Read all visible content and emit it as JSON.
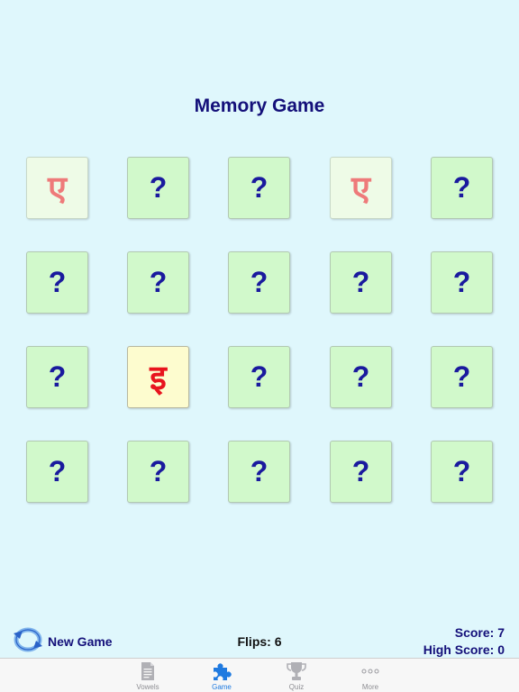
{
  "title": "Memory Game",
  "cards": [
    {
      "state": "matched",
      "text": "ए"
    },
    {
      "state": "hidden",
      "text": "?"
    },
    {
      "state": "hidden",
      "text": "?"
    },
    {
      "state": "matched",
      "text": "ए"
    },
    {
      "state": "hidden",
      "text": "?"
    },
    {
      "state": "hidden",
      "text": "?"
    },
    {
      "state": "hidden",
      "text": "?"
    },
    {
      "state": "hidden",
      "text": "?"
    },
    {
      "state": "hidden",
      "text": "?"
    },
    {
      "state": "hidden",
      "text": "?"
    },
    {
      "state": "hidden",
      "text": "?"
    },
    {
      "state": "revealed",
      "text": "इ"
    },
    {
      "state": "hidden",
      "text": "?"
    },
    {
      "state": "hidden",
      "text": "?"
    },
    {
      "state": "hidden",
      "text": "?"
    },
    {
      "state": "hidden",
      "text": "?"
    },
    {
      "state": "hidden",
      "text": "?"
    },
    {
      "state": "hidden",
      "text": "?"
    },
    {
      "state": "hidden",
      "text": "?"
    },
    {
      "state": "hidden",
      "text": "?"
    }
  ],
  "bottom": {
    "new_game_label": "New Game",
    "flips_label": "Flips: 6",
    "score_label": "Score: 7",
    "high_score_label": "High Score: 0"
  },
  "tabs": [
    {
      "label": "Vowels",
      "icon": "document-icon",
      "active": false
    },
    {
      "label": "Game",
      "icon": "puzzle-icon",
      "active": true
    },
    {
      "label": "Quiz",
      "icon": "trophy-icon",
      "active": false
    },
    {
      "label": "More",
      "icon": "more-icon",
      "active": false
    }
  ],
  "colors": {
    "background": "#dff7fc",
    "card_hidden": "#d1f9cb",
    "card_revealed": "#fdfccf",
    "title": "#14107a",
    "tab_active": "#1f7ae0"
  }
}
